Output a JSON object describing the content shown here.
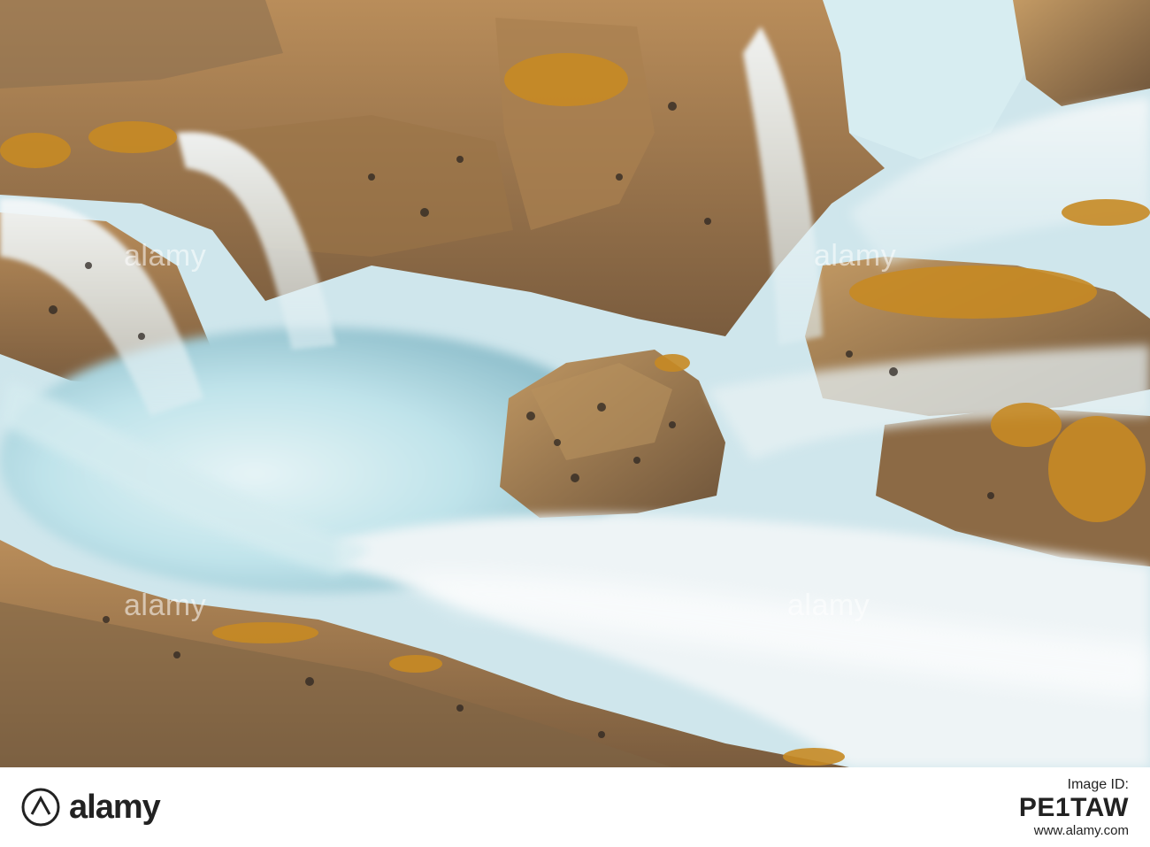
{
  "photo": {
    "subject": "long-exposure-coastal-rock-waterfall",
    "colors": {
      "rock_warm": "#b98d5a",
      "rock_shadow": "#5a4a3a",
      "moss": "#c78a24",
      "water_white": "#eef4f6",
      "water_cyan": "#bfe3ea",
      "water_deep": "#8fbfcc"
    }
  },
  "watermark": {
    "text": "alamy"
  },
  "footer": {
    "brand": "alamy",
    "image_id_label": "Image ID:",
    "image_id": "PE1TAW",
    "url": "www.alamy.com"
  }
}
